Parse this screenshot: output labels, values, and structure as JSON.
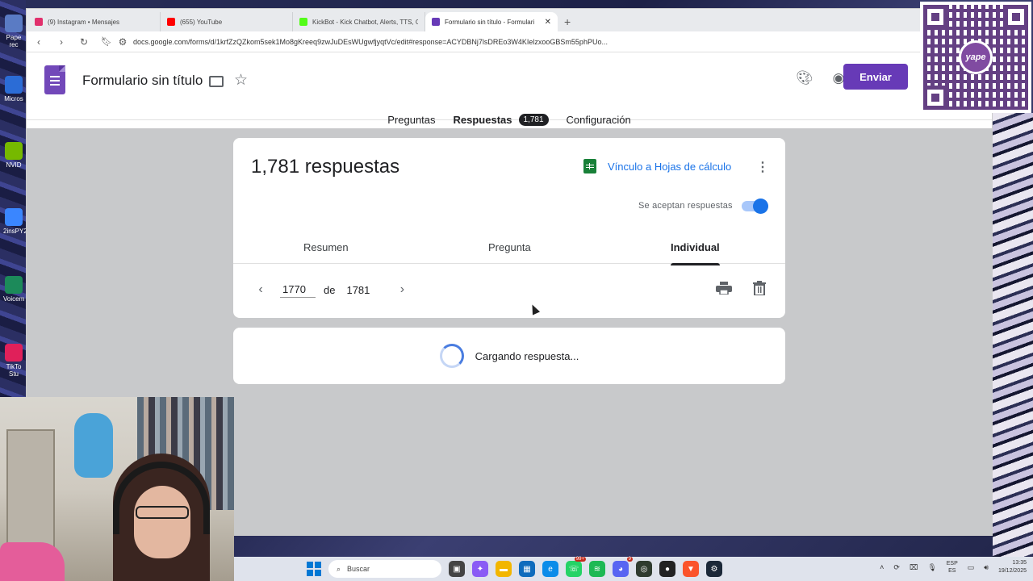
{
  "browser": {
    "tabs": [
      {
        "title": "(9) Instagram • Mensajes",
        "color": "#e1306c"
      },
      {
        "title": "(655) YouTube",
        "color": "#ff0000"
      },
      {
        "title": "KickBot - Kick Chatbot, Alerts, TTS, C",
        "color": "#53fc18"
      },
      {
        "title": "Formulario sin título - Formulari",
        "color": "#673ab7"
      }
    ],
    "url": "docs.google.com/forms/d/1krfZzQZkom5sek1Mo8gKreeq9zwJuDEsWUgwfjyqtVc/edit#response=ACYDBNj7lsDREo3W4KIelzxooGBSm55phPUo..."
  },
  "forms": {
    "title": "Formulario sin título",
    "send_label": "Enviar",
    "tabs": {
      "questions": "Preguntas",
      "responses": "Respuestas",
      "responses_badge": "1,781",
      "settings": "Configuración"
    }
  },
  "responses": {
    "count_label": "1,781 respuestas",
    "sheets_link": "Vínculo a Hojas de cálculo",
    "accepting_label": "Se aceptan respuestas",
    "accepting": true,
    "subtabs": {
      "summary": "Resumen",
      "question": "Pregunta",
      "individual": "Individual"
    },
    "pager": {
      "current": "1770",
      "of_label": "de",
      "total": "1781"
    },
    "loading_text": "Cargando respuesta..."
  },
  "desktop": {
    "icons": [
      "Pape rec",
      "Micros",
      "NVID",
      "2insPY2",
      "Voicem",
      "TikTo Stu"
    ]
  },
  "qr": {
    "brand": "yape"
  },
  "taskbar": {
    "search_placeholder": "Buscar",
    "badge_whatsapp": "99+",
    "badge_discord": "9",
    "lang": "ESP",
    "lang_sub": "ES",
    "time": "13:35",
    "date": "19/12/2025"
  }
}
